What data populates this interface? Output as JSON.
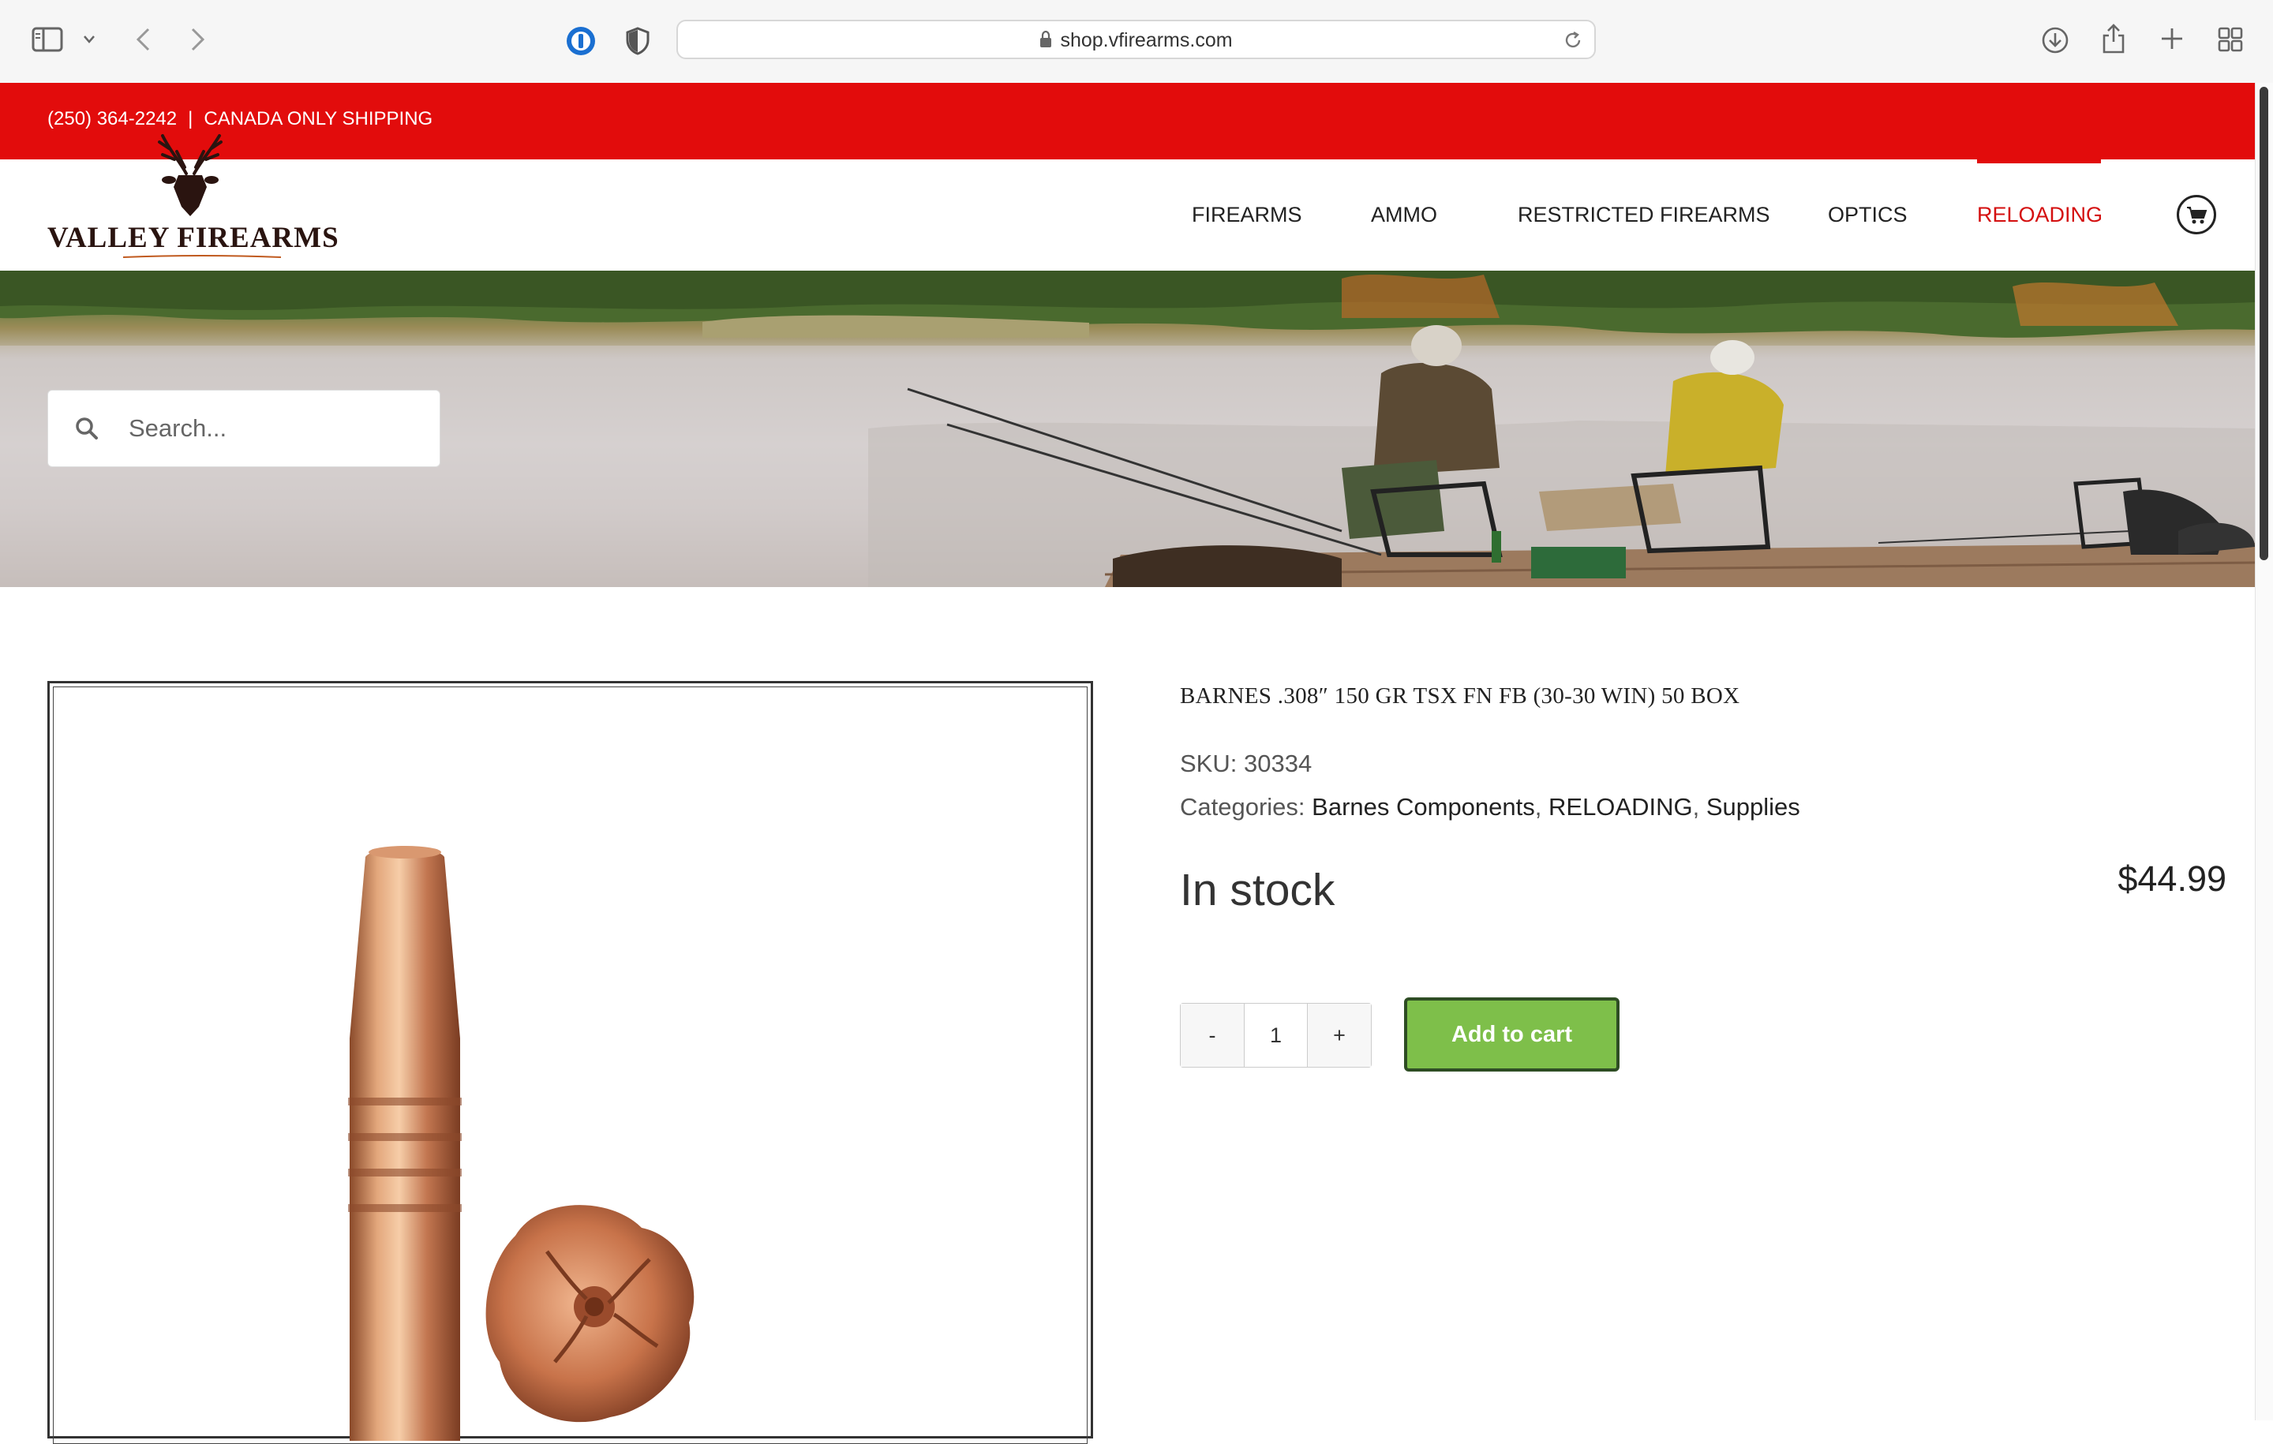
{
  "browser": {
    "url": "shop.vfirearms.com",
    "icons": [
      "sidebar-icon",
      "chevron-down-icon",
      "back-icon",
      "forward-icon",
      "password-manager-icon",
      "privacy-shield-icon",
      "lock-icon",
      "reload-icon",
      "download-icon",
      "share-icon",
      "new-tab-icon",
      "tab-overview-icon"
    ]
  },
  "topbar": {
    "phone": "(250) 364-2242",
    "separator": "|",
    "shipping": "CANADA ONLY SHIPPING"
  },
  "header": {
    "logo_text": "VALLEY FIREARMS",
    "nav": [
      {
        "label": "FIREARMS",
        "active": false
      },
      {
        "label": "AMMO",
        "active": false
      },
      {
        "label": "RESTRICTED FIREARMS",
        "active": false
      },
      {
        "label": "OPTICS",
        "active": false
      },
      {
        "label": "RELOADING",
        "active": true
      }
    ],
    "cart_icon": "cart-icon"
  },
  "search": {
    "placeholder": "Search..."
  },
  "product": {
    "title": "BARNES .308″ 150 GR TSX FN FB (30-30 WIN) 50 BOX",
    "sku_label": "SKU:",
    "sku": "30334",
    "categories_label": "Categories:",
    "categories": [
      "Barnes Components",
      "RELOADING",
      "Supplies"
    ],
    "stock": "In stock",
    "price": "$44.99",
    "quantity": "1",
    "minus_label": "-",
    "plus_label": "+",
    "add_to_cart": "Add to cart"
  },
  "colors": {
    "brand_red": "#e20c0c",
    "add_to_cart_green": "#7ebf4a",
    "nav_active": "#d40f0f"
  }
}
